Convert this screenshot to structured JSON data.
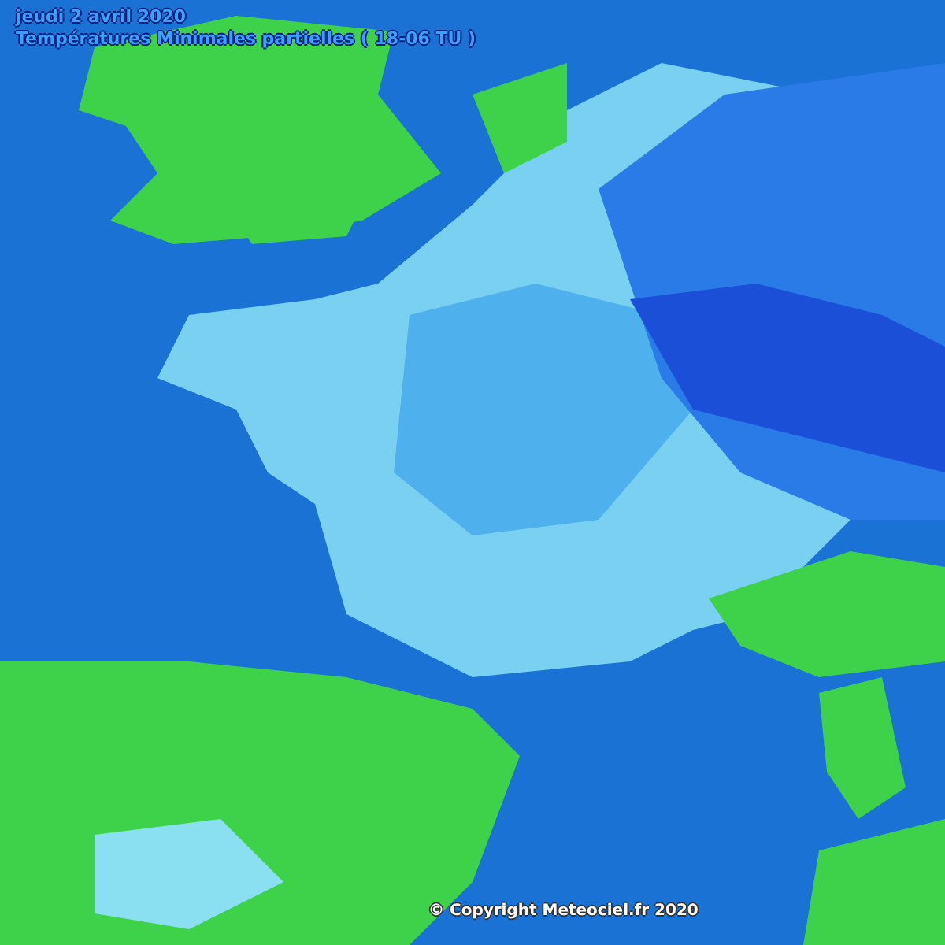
{
  "header": {
    "date": "jeudi 2 avril 2020",
    "subtitle": "Températures Minimales partielles ( 18-06 TU )"
  },
  "map": {
    "copyright": "© Copyright Meteociel.fr 2020"
  }
}
